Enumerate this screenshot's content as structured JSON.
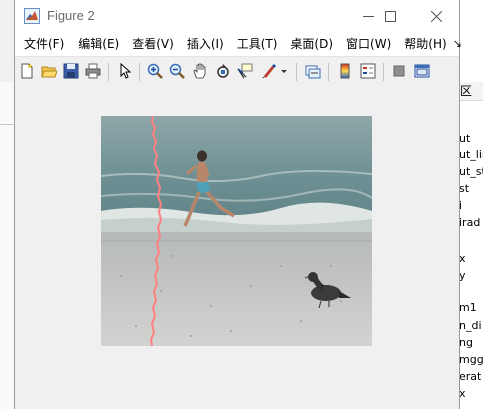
{
  "window": {
    "title": "Figure 2"
  },
  "menu": {
    "items": [
      "文件(F)",
      "编辑(E)",
      "查看(V)",
      "插入(I)",
      "工具(T)",
      "桌面(D)",
      "窗口(W)",
      "帮助(H)"
    ],
    "more": "↘"
  },
  "toolbar": {
    "icons": [
      "new-figure-icon",
      "open-file-icon",
      "save-icon",
      "print-icon",
      "select-arrow-icon",
      "zoom-in-icon",
      "zoom-out-icon",
      "pan-hand-icon",
      "rotate-3d-icon",
      "data-cursor-icon",
      "brush-icon",
      "brush-dropdown-icon",
      "link-plot-icon",
      "colorbar-icon",
      "legend-icon",
      "hide-plot-tools-icon",
      "show-plot-tools-icon"
    ]
  },
  "background_panel": {
    "header": "区",
    "items": [
      "ut",
      "ut_lin",
      "ut_st",
      "st",
      "i",
      "irad",
      "",
      "x",
      "y",
      "",
      "m1",
      "n_di",
      "ng",
      "mgg",
      "erat",
      "x"
    ]
  }
}
